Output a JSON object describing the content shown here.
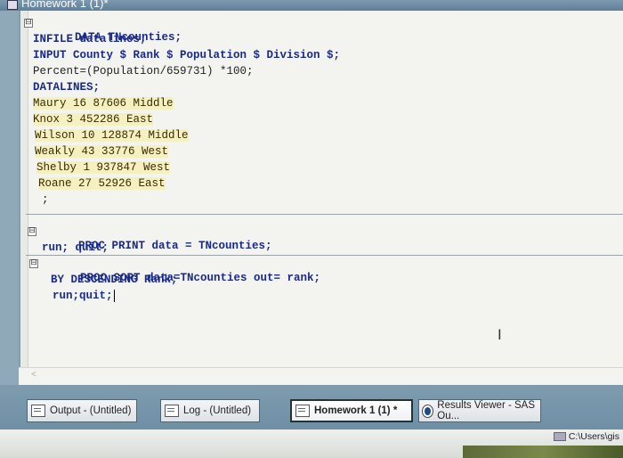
{
  "window": {
    "title": "Homework 1 (1)*"
  },
  "code_lines": [
    "DATA TNcounties;",
    "INFILE datalines;",
    "INPUT County $ Rank $ Population $ Division $;",
    "Percent=(Population/659731) *100;",
    "DATALINES;",
    "Maury 16 87606 Middle",
    "Knox 3 452286 East",
    "Wilson 10 128874 Middle",
    "Weakly 43 33776 West",
    "Shelby 1 937847 West",
    "Roane 27 52926 East",
    ";",
    "PROC PRINT data = TNcounties;",
    "run; quit;",
    "PROC SORT data=TNcounties out= rank;",
    "BY DESCENDING Rank;",
    "run;quit;"
  ],
  "fold_markers": [
    "⊟",
    "⊟",
    "⊟"
  ],
  "scroll_arrow": "<",
  "taskbar": {
    "tabs": [
      {
        "label": "Output - (Untitled)",
        "icon": "output-window-icon"
      },
      {
        "label": "Log - (Untitled)",
        "icon": "log-window-icon"
      },
      {
        "label": "Homework 1 (1) *",
        "icon": "program-editor-icon"
      },
      {
        "label": "Results Viewer - SAS Ou...",
        "icon": "results-viewer-icon"
      }
    ]
  },
  "status": {
    "path": "C:\\Users\\gis"
  },
  "colors": {
    "keyword": "#1a2a8a",
    "data_highlight": "#f4f0c0",
    "taskbar": "#7f9caf"
  }
}
